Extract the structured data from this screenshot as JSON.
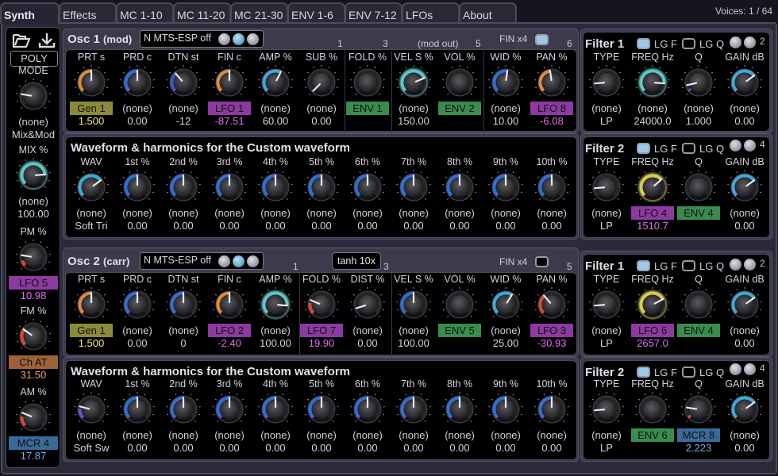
{
  "tabs": [
    {
      "label": "Synth",
      "active": true
    },
    {
      "label": "Effects"
    },
    {
      "label": "MC 1-10"
    },
    {
      "label": "MC 11-20"
    },
    {
      "label": "MC 21-30"
    },
    {
      "label": "ENV 1-6"
    },
    {
      "label": "ENV 7-12"
    },
    {
      "label": "LFOs"
    },
    {
      "label": "About"
    }
  ],
  "voices": "Voices: 1 / 64",
  "colors": {
    "orange": "#e08a3a",
    "blue": "#2f6fd8",
    "darkblue": "#3a56c8",
    "cyan": "#5fc6c6",
    "lightblue": "#3fa8d8",
    "yellow": "#d8cc50",
    "purple": "#7a4ad0",
    "red": "#d84a2a",
    "gen": "#8a8a3a",
    "lfo": "#8c3aa0",
    "env": "#3a8c4e",
    "chat": "#a0603a",
    "mcr": "#3a6a9a",
    "val_gen": "#f0f070",
    "val_lfo": "#e070f0",
    "val_chat": "#f0a070",
    "val_mcr": "#70b0f0"
  },
  "side": {
    "icons": [
      "folder-open-icon",
      "download-icon"
    ],
    "poly_label": "POLY",
    "knobs": [
      {
        "label": "MODE",
        "mod": "(none)",
        "value": "Mix&Mod",
        "pos": 0.2,
        "arc": null
      },
      {
        "label": "MIX %",
        "mod": "(none)",
        "value": "100.00",
        "pos": 0.82,
        "arc": "cyan",
        "glow": true
      },
      {
        "label": "PM %",
        "mod": "LFO 5",
        "modType": "lfo",
        "value": "10.98",
        "valType": "val_lfo",
        "pos": 0.2,
        "arc": "red",
        "arcFrom": 0,
        "arcTo": 0.1
      },
      {
        "label": "FM %",
        "mod": "Ch AT",
        "modType": "chat",
        "value": "31.50",
        "valType": "val_chat",
        "pos": 0.3,
        "arc": "red",
        "arcFrom": 0,
        "arcTo": 0.32
      },
      {
        "label": "AM %",
        "mod": "MCR 4",
        "modType": "mcr",
        "value": "17.87",
        "valType": "val_mcr",
        "pos": 0.25,
        "arc": "red",
        "arcFrom": 0,
        "arcTo": 0.18
      }
    ]
  },
  "osc1": {
    "title": "Osc 1",
    "subtitle": "(mod)",
    "tuning": "N MTS-ESP off",
    "fin_label": "FIN x4",
    "fin_checked": true,
    "numbers": [
      "1",
      "3",
      "(mod out)",
      "5",
      "6"
    ],
    "knobs": [
      {
        "label": "PRT s",
        "mod": "Gen 1",
        "modType": "gen",
        "value": "1.500",
        "valType": "val_gen",
        "pos": 0.5,
        "arc": "orange"
      },
      {
        "label": "PRD c",
        "mod": "(none)",
        "value": "0.00",
        "pos": 0.5,
        "arc": "blue"
      },
      {
        "label": "DTN st",
        "mod": "(none)",
        "value": "-12",
        "pos": 0.35,
        "arc": "darkblue"
      },
      {
        "label": "FIN c",
        "mod": "LFO 1",
        "modType": "lfo",
        "value": "-87.51",
        "valType": "val_lfo",
        "pos": 0.5,
        "arc": "orange"
      },
      {
        "label": "AMP %",
        "mod": "(none)",
        "value": "60.00",
        "pos": 0.6,
        "arc": "lightblue"
      },
      {
        "label": "SUB %",
        "mod": "(none)",
        "value": "0.00",
        "pos": 0.0,
        "arc": null
      },
      {
        "label": "FOLD %",
        "mod": "ENV 1",
        "modType": "env",
        "value": "",
        "pos": 0.0,
        "arc": null,
        "noNeedle": true
      },
      {
        "label": "VEL S %",
        "mod": "(none)",
        "value": "150.00",
        "pos": 0.75,
        "arc": "cyan",
        "glow": true
      },
      {
        "label": "VOL %",
        "mod": "ENV 2",
        "modType": "env",
        "value": "",
        "pos": 0.0,
        "arc": null,
        "noNeedle": true
      },
      {
        "label": "WID %",
        "mod": "(none)",
        "value": "10.00",
        "pos": 0.53,
        "arc": "blue"
      },
      {
        "label": "PAN %",
        "mod": "LFO 8",
        "modType": "lfo",
        "value": "-6.08",
        "valType": "val_lfo",
        "pos": 0.47,
        "arc": "orange"
      }
    ]
  },
  "wave1": {
    "title": "Waveform & harmonics for the Custom waveform",
    "knobs": [
      {
        "label": "WAV",
        "mod": "(none)",
        "value": "Soft Tri",
        "pos": 0.7,
        "arc": "lightblue"
      },
      {
        "label": "1st %",
        "mod": "(none)",
        "value": "0.00",
        "pos": 0.5,
        "arc": "blue"
      },
      {
        "label": "2nd %",
        "mod": "(none)",
        "value": "0.00",
        "pos": 0.5,
        "arc": "blue"
      },
      {
        "label": "3rd %",
        "mod": "(none)",
        "value": "0.00",
        "pos": 0.5,
        "arc": "blue"
      },
      {
        "label": "4th %",
        "mod": "(none)",
        "value": "0.00",
        "pos": 0.5,
        "arc": "blue"
      },
      {
        "label": "5th %",
        "mod": "(none)",
        "value": "0.00",
        "pos": 0.5,
        "arc": "blue"
      },
      {
        "label": "6th %",
        "mod": "(none)",
        "value": "0.00",
        "pos": 0.5,
        "arc": "blue"
      },
      {
        "label": "7th %",
        "mod": "(none)",
        "value": "0.00",
        "pos": 0.5,
        "arc": "blue"
      },
      {
        "label": "8th %",
        "mod": "(none)",
        "value": "0.00",
        "pos": 0.5,
        "arc": "blue"
      },
      {
        "label": "9th %",
        "mod": "(none)",
        "value": "0.00",
        "pos": 0.5,
        "arc": "blue"
      },
      {
        "label": "10th %",
        "mod": "(none)",
        "value": "0.00",
        "pos": 0.5,
        "arc": "blue"
      }
    ]
  },
  "filter1a": {
    "title": "Filter 1",
    "lgf": "LG F",
    "lgq": "LG Q",
    "lgf_on": true,
    "lgq_on": false,
    "number": "2",
    "knobs": [
      {
        "label": "TYPE",
        "mod": "(none)",
        "value": "LP",
        "pos": 0.15,
        "arc": null
      },
      {
        "label": "FREQ Hz",
        "mod": "(none)",
        "value": "24000.0",
        "pos": 0.85,
        "arc": "cyan",
        "glow": true
      },
      {
        "label": "Q",
        "mod": "(none)",
        "value": "1.000",
        "pos": 0.12,
        "arc": "purple",
        "arcFrom": 0,
        "arcTo": 0.04
      },
      {
        "label": "GAIN dB",
        "mod": "(none)",
        "value": "0.00",
        "pos": 0.7,
        "arc": "lightblue"
      }
    ]
  },
  "filter2a": {
    "title": "Filter 2",
    "lgf": "LG F",
    "lgq": "LG Q",
    "lgf_on": true,
    "lgq_on": false,
    "number": "4",
    "knobs": [
      {
        "label": "TYPE",
        "mod": "(none)",
        "value": "LP",
        "pos": 0.15,
        "arc": null
      },
      {
        "label": "FREQ Hz",
        "mod": "LFO 4",
        "modType": "lfo",
        "value": "1510.7",
        "valType": "val_lfo",
        "pos": 0.68,
        "arc": "yellow",
        "glow": true
      },
      {
        "label": "Q",
        "mod": "ENV 4",
        "modType": "env",
        "value": "",
        "pos": 0.0,
        "arc": null,
        "noNeedle": true
      },
      {
        "label": "GAIN dB",
        "mod": "(none)",
        "value": "0.00",
        "pos": 0.7,
        "arc": "lightblue"
      }
    ]
  },
  "osc2": {
    "title": "Osc 2",
    "subtitle": "(carr)",
    "tuning": "N MTS-ESP off",
    "distortion": "tanh 10x",
    "fin_label": "FIN x4",
    "fin_checked": false,
    "numbers": [
      "1",
      "3",
      "5"
    ],
    "knobs": [
      {
        "label": "PRT s",
        "mod": "Gen 1",
        "modType": "gen",
        "value": "1.500",
        "valType": "val_gen",
        "pos": 0.5,
        "arc": "orange"
      },
      {
        "label": "PRD c",
        "mod": "(none)",
        "value": "0.00",
        "pos": 0.5,
        "arc": "blue"
      },
      {
        "label": "DTN st",
        "mod": "(none)",
        "value": "0",
        "pos": 0.5,
        "arc": "blue"
      },
      {
        "label": "FIN c",
        "mod": "LFO 2",
        "modType": "lfo",
        "value": "-2.40",
        "valType": "val_lfo",
        "pos": 0.5,
        "arc": "orange"
      },
      {
        "label": "AMP %",
        "mod": "(none)",
        "value": "100.00",
        "pos": 0.85,
        "arc": "cyan",
        "glow": true
      },
      {
        "label": "FOLD %",
        "mod": "LFO 7",
        "modType": "lfo",
        "value": "19.90",
        "valType": "val_lfo",
        "pos": 0.25,
        "arc": "red",
        "arcFrom": 0,
        "arcTo": 0.2
      },
      {
        "label": "DIST %",
        "mod": "(none)",
        "value": "0.00",
        "pos": 0.1,
        "arc": null
      },
      {
        "label": "VEL S %",
        "mod": "(none)",
        "value": "100.00",
        "pos": 0.5,
        "arc": "blue"
      },
      {
        "label": "VOL %",
        "mod": "ENV 5",
        "modType": "env",
        "value": "",
        "pos": 0.0,
        "arc": null,
        "noNeedle": true
      },
      {
        "label": "WID %",
        "mod": "(none)",
        "value": "25.00",
        "pos": 0.62,
        "arc": "lightblue"
      },
      {
        "label": "PAN %",
        "mod": "LFO 3",
        "modType": "lfo",
        "value": "-30.93",
        "valType": "val_lfo",
        "pos": 0.35,
        "arc": "red",
        "arcFrom": 0,
        "arcTo": 0.35
      }
    ]
  },
  "wave2": {
    "title": "Waveform & harmonics for the Custom waveform",
    "knobs": [
      {
        "label": "WAV",
        "mod": "(none)",
        "value": "Soft Sw",
        "pos": 0.22,
        "arc": "purple",
        "arcFrom": 0,
        "arcTo": 0.18
      },
      {
        "label": "1st %",
        "mod": "(none)",
        "value": "0.00",
        "pos": 0.5,
        "arc": "blue"
      },
      {
        "label": "2nd %",
        "mod": "(none)",
        "value": "0.00",
        "pos": 0.5,
        "arc": "blue"
      },
      {
        "label": "3rd %",
        "mod": "(none)",
        "value": "0.00",
        "pos": 0.5,
        "arc": "blue"
      },
      {
        "label": "4th %",
        "mod": "(none)",
        "value": "0.00",
        "pos": 0.5,
        "arc": "blue"
      },
      {
        "label": "5th %",
        "mod": "(none)",
        "value": "0.00",
        "pos": 0.5,
        "arc": "blue"
      },
      {
        "label": "6th %",
        "mod": "(none)",
        "value": "0.00",
        "pos": 0.5,
        "arc": "blue"
      },
      {
        "label": "7th %",
        "mod": "(none)",
        "value": "0.00",
        "pos": 0.5,
        "arc": "blue"
      },
      {
        "label": "8th %",
        "mod": "(none)",
        "value": "0.00",
        "pos": 0.5,
        "arc": "blue"
      },
      {
        "label": "9th %",
        "mod": "(none)",
        "value": "0.00",
        "pos": 0.5,
        "arc": "blue"
      },
      {
        "label": "10th %",
        "mod": "(none)",
        "value": "0.00",
        "pos": 0.5,
        "arc": "blue"
      }
    ]
  },
  "filter1b": {
    "title": "Filter 1",
    "lgf": "LG F",
    "lgq": "LG Q",
    "lgf_on": true,
    "lgq_on": false,
    "number": "2",
    "knobs": [
      {
        "label": "TYPE",
        "mod": "(none)",
        "value": "LP",
        "pos": 0.15,
        "arc": null
      },
      {
        "label": "FREQ Hz",
        "mod": "LFO 6",
        "modType": "lfo",
        "value": "2657.0",
        "valType": "val_lfo",
        "pos": 0.73,
        "arc": "yellow",
        "glow": true
      },
      {
        "label": "Q",
        "mod": "ENV 4",
        "modType": "env",
        "value": "",
        "pos": 0.0,
        "arc": null,
        "noNeedle": true
      },
      {
        "label": "GAIN dB",
        "mod": "(none)",
        "value": "0.00",
        "pos": 0.7,
        "arc": "lightblue"
      }
    ]
  },
  "filter2b": {
    "title": "Filter 2",
    "lgf": "LG F",
    "lgq": "LG Q",
    "lgf_on": true,
    "lgq_on": false,
    "number": "4",
    "knobs": [
      {
        "label": "TYPE",
        "mod": "(none)",
        "value": "LP",
        "pos": 0.15,
        "arc": null
      },
      {
        "label": "FREQ Hz",
        "mod": "ENV 6",
        "modType": "env",
        "value": "",
        "pos": 0.0,
        "arc": null,
        "noNeedle": true
      },
      {
        "label": "Q",
        "mod": "MCR 8",
        "modType": "mcr",
        "value": "2.223",
        "valType": "val_mcr",
        "pos": 0.2,
        "arc": "red",
        "arcFrom": 0,
        "arcTo": 0.05
      },
      {
        "label": "GAIN dB",
        "mod": "(none)",
        "value": "0.00",
        "pos": 0.7,
        "arc": "lightblue"
      }
    ]
  }
}
